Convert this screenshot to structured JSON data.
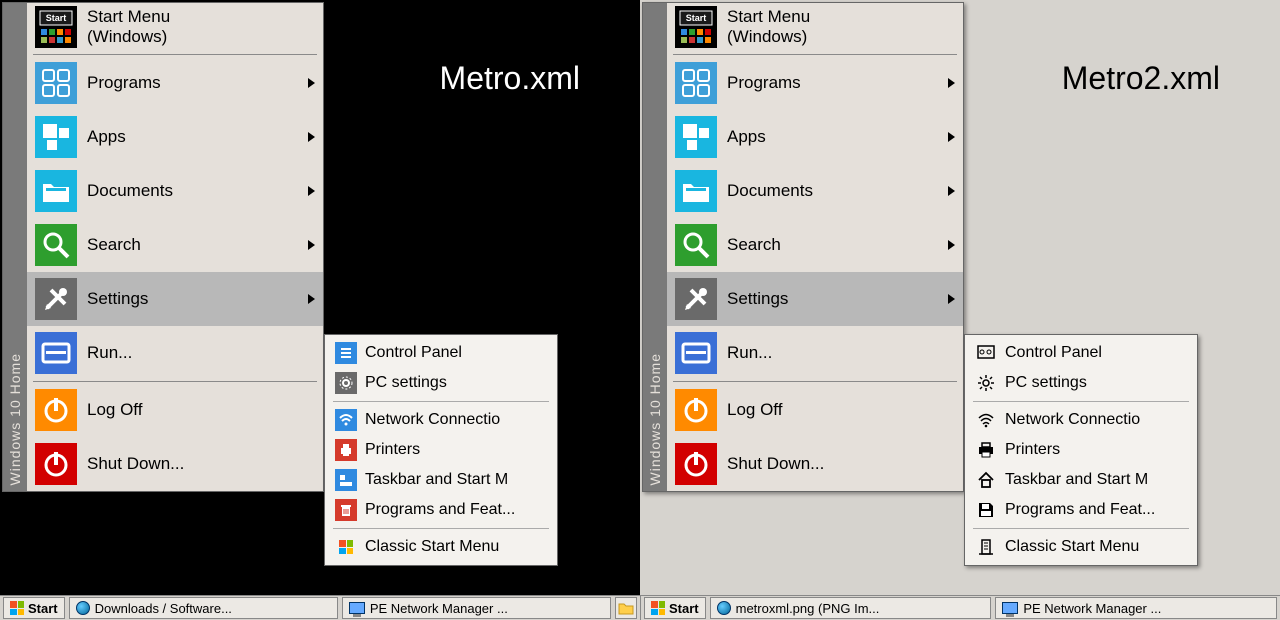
{
  "captions": {
    "left": "Metro.xml",
    "right": "Metro2.xml"
  },
  "sidebar": "Windows 10 Home",
  "menu": {
    "header": {
      "line1": "Start Menu",
      "line2": "(Windows)"
    },
    "programs": "Programs",
    "apps": "Apps",
    "documents": "Documents",
    "search": "Search",
    "settings": "Settings",
    "run": "Run...",
    "logoff": "Log Off",
    "shutdown": "Shut Down..."
  },
  "sub": {
    "control_panel": "Control Panel",
    "pc_settings": "PC settings",
    "network": "Network Connectio",
    "printers": "Printers",
    "taskbar": "Taskbar and Start M",
    "progfeat": "Programs and Feat...",
    "classic": "Classic Start Menu"
  },
  "taskbar": {
    "start": "Start",
    "left": {
      "btn1": "Downloads / Software...",
      "btn2": "PE Network Manager ..."
    },
    "right": {
      "btn1": "metroxml.png (PNG Im...",
      "btn2": "PE Network Manager ..."
    }
  },
  "colors": {
    "programs": "#3e9fd8",
    "apps": "#19b6e0",
    "documents": "#19b6e0",
    "search": "#2e9e2e",
    "settings": "#6a6a6a",
    "run": "#3a6fd6",
    "logoff": "#ff8a00",
    "shutdown": "#d20000",
    "sub_cp": "#2f8ae0",
    "sub_net": "#2f8ae0",
    "sub_prn": "#d53a2b",
    "sub_tbar": "#2f8ae0",
    "sub_prog": "#d53a2b"
  }
}
